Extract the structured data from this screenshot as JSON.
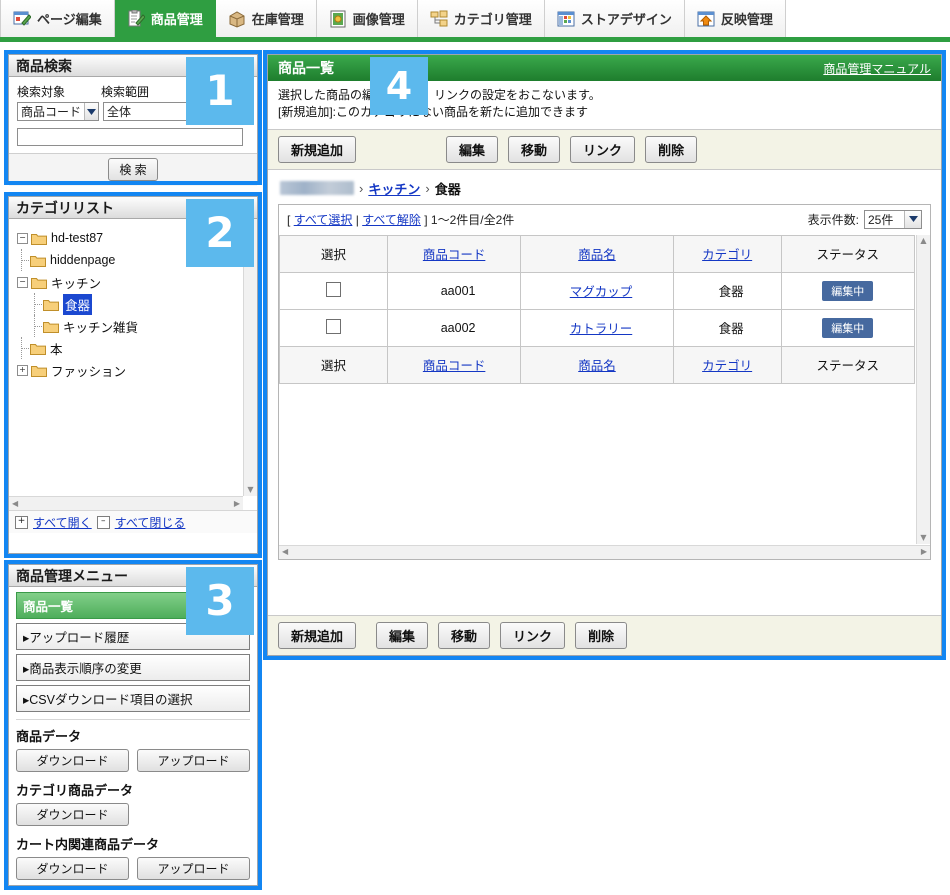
{
  "tabs": [
    {
      "label": "ページ編集",
      "icon": "page-edit-icon",
      "active": false
    },
    {
      "label": "商品管理",
      "icon": "product-manage-icon",
      "active": true
    },
    {
      "label": "在庫管理",
      "icon": "inventory-icon",
      "active": false
    },
    {
      "label": "画像管理",
      "icon": "image-manage-icon",
      "active": false
    },
    {
      "label": "カテゴリ管理",
      "icon": "category-manage-icon",
      "active": false
    },
    {
      "label": "ストアデザイン",
      "icon": "store-design-icon",
      "active": false
    },
    {
      "label": "反映管理",
      "icon": "publish-icon",
      "active": false
    }
  ],
  "badges": {
    "one": "1",
    "two": "2",
    "three": "3",
    "four": "4"
  },
  "search": {
    "title": "商品検索",
    "label_target": "検索対象",
    "label_range": "検索範囲",
    "target_value": "商品コード",
    "range_value": "全体",
    "keyword_value": "",
    "keyword_placeholder": "",
    "submit_label": "検 索"
  },
  "category": {
    "title": "カテゴリリスト",
    "nodes": [
      {
        "label": "hd-test87",
        "depth": 0,
        "toggle": "minus",
        "selected": false
      },
      {
        "label": "hiddenpage",
        "depth": 1,
        "toggle": "none",
        "selected": false
      },
      {
        "label": "キッチン",
        "depth": 1,
        "toggle": "minus",
        "selected": false
      },
      {
        "label": "食器",
        "depth": 2,
        "toggle": "none",
        "selected": true
      },
      {
        "label": "キッチン雑貨",
        "depth": 2,
        "toggle": "none",
        "selected": false
      },
      {
        "label": "本",
        "depth": 1,
        "toggle": "none",
        "selected": false
      },
      {
        "label": "ファッション",
        "depth": 1,
        "toggle": "plus",
        "selected": false
      }
    ],
    "expand_all": "すべて開く",
    "collapse_all": "すべて閉じる",
    "expand_icon": "+",
    "collapse_icon": "–"
  },
  "menu": {
    "title": "商品管理メニュー",
    "items": [
      {
        "label": "商品一覧",
        "current": true
      },
      {
        "label": "▸アップロード履歴",
        "current": false
      },
      {
        "label": "▸商品表示順序の変更",
        "current": false
      },
      {
        "label": "▸CSVダウンロード項目の選択",
        "current": false
      }
    ],
    "sections": [
      {
        "title": "商品データ",
        "buttons": [
          "ダウンロード",
          "アップロード"
        ]
      },
      {
        "title": "カテゴリ商品データ",
        "buttons": [
          "ダウンロード"
        ]
      },
      {
        "title": "カート内関連商品データ",
        "buttons": [
          "ダウンロード",
          "アップロード"
        ]
      }
    ]
  },
  "main": {
    "title": "商品一覧",
    "manual_link": "商品管理マニュアル",
    "description_line1": "選択した商品の編集、移動、リンクの設定をおこないます。",
    "description_line2": "[新規追加]:このカテゴリにない商品を新たに追加できます",
    "toolbar": {
      "add_label": "新規追加",
      "edit_label": "編集",
      "move_label": "移動",
      "link_label": "リンク",
      "delete_label": "削除"
    },
    "breadcrumb": {
      "root_redacted": "",
      "items": [
        "キッチン",
        "食器"
      ],
      "separator": "›"
    },
    "list": {
      "select_all": "すべて選択",
      "deselect_all": "すべて解除",
      "bracket_open": "[",
      "bracket_close": "]",
      "divider": "|",
      "count_text": "1〜2件目/全2件",
      "per_page_label": "表示件数:",
      "per_page_value": "25件",
      "columns": [
        "選択",
        "商品コード",
        "商品名",
        "カテゴリ",
        "ステータス"
      ],
      "rows": [
        {
          "checked": false,
          "code": "aa001",
          "name": "マグカップ",
          "category": "食器",
          "status": "編集中"
        },
        {
          "checked": false,
          "code": "aa002",
          "name": "カトラリー",
          "category": "食器",
          "status": "編集中"
        }
      ]
    }
  },
  "colors": {
    "brand_green": "#2f9e41",
    "highlight_blue": "#1386f2",
    "badge_blue": "#5cb9ed",
    "link_blue": "#1437c4",
    "status_badge": "#46699f",
    "tree_select": "#1b48d0"
  }
}
